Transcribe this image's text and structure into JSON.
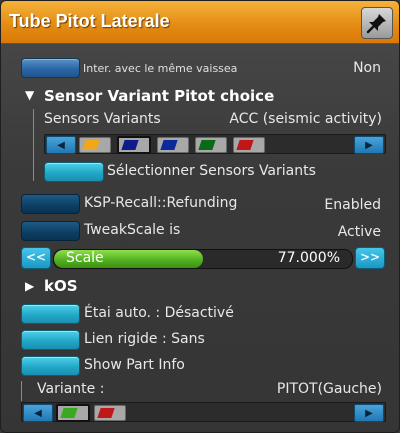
{
  "window": {
    "title": "Tube Pitot Laterale",
    "pin_icon": "pin-icon"
  },
  "colors": {
    "titlebar": "#e38a12",
    "button_blue": "#2a67a6",
    "button_cyan": "#22a8c8",
    "scale_fill": "#4fae1f"
  },
  "inter_vessel": {
    "label": "Inter. avec le même vaissea",
    "value": "Non"
  },
  "sensor_section": {
    "header": "Sensor Variant Pitot choice",
    "variants_label": "Sensors Variants",
    "variants_value": "ACC (seismic activity)",
    "swatches": [
      "#f0a818",
      "#101a8a",
      "#0a2a9a",
      "#0a6a18",
      "#c01818"
    ],
    "select_button": "Sélectionner Sensors Variants"
  },
  "refunding": {
    "label": "KSP-Recall::Refunding",
    "value": "Enabled"
  },
  "tweakscale": {
    "label": "TweakScale is",
    "value": "Active"
  },
  "scale": {
    "left_button": "<<",
    "right_button": ">>",
    "label": "Scale",
    "value": "77.000%",
    "fill_fraction": 0.5
  },
  "kos": {
    "header": "kOS"
  },
  "toggles": {
    "auto_strut": "Étai auto. : Désactivé",
    "rigid_link": "Lien rigide : Sans",
    "part_info": "Show Part Info"
  },
  "variant": {
    "label": "Variante :",
    "value": "PITOT(Gauche)",
    "swatches": [
      "#3aa820",
      "#c01818"
    ]
  }
}
